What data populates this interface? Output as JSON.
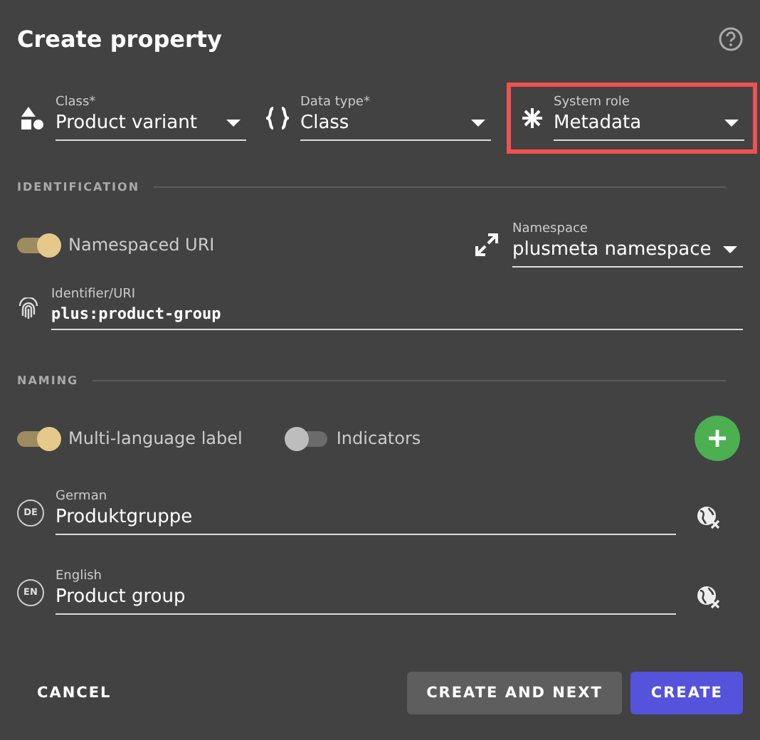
{
  "title": "Create property",
  "selects": [
    {
      "kind": "shapes",
      "label": "Class*",
      "value": "Product variant",
      "highlighted": false
    },
    {
      "kind": "braces",
      "label": "Data type*",
      "value": "Class",
      "highlighted": false
    },
    {
      "kind": "asterisk",
      "label": "System role",
      "value": "Metadata",
      "highlighted": true
    }
  ],
  "identification": {
    "heading": "IDENTIFICATION",
    "toggle": {
      "label": "Namespaced URI",
      "on": true
    },
    "namespace": {
      "label": "Namespace",
      "value": "plusmeta namespace"
    },
    "identifier": {
      "label": "Identifier/URI",
      "value": "plus:product-group"
    }
  },
  "naming": {
    "heading": "NAMING",
    "toggles": [
      {
        "label": "Multi-language label",
        "on": true
      },
      {
        "label": "Indicators",
        "on": false
      }
    ],
    "languages": [
      {
        "code": "DE",
        "label": "German",
        "value": "Produktgruppe"
      },
      {
        "code": "EN",
        "label": "English",
        "value": "Product group"
      }
    ]
  },
  "buttons": [
    {
      "kind": "text",
      "label": "CANCEL"
    },
    {
      "kind": "secondary",
      "label": "CREATE AND NEXT"
    },
    {
      "kind": "primary",
      "label": "CREATE"
    }
  ]
}
